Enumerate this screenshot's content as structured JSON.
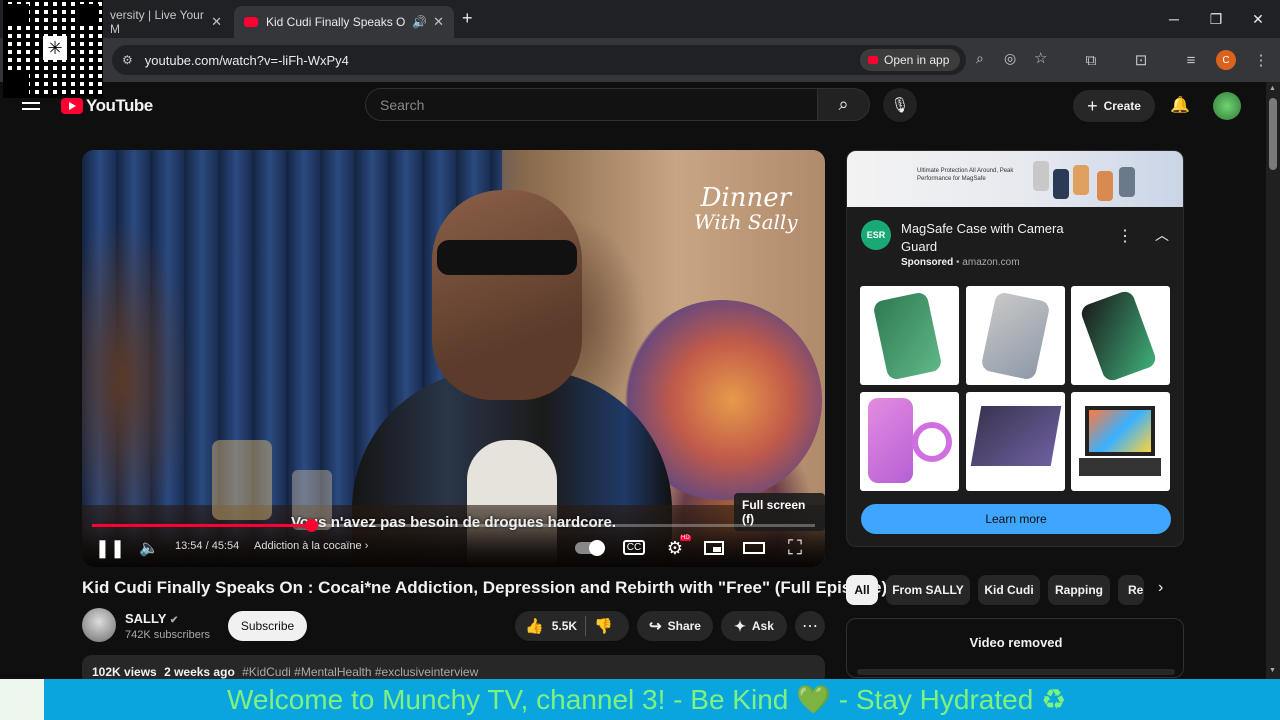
{
  "browser": {
    "tabs": [
      {
        "label": "versity | Live Your M",
        "active": false
      },
      {
        "label": "Kid Cudi Finally Speaks On :",
        "active": true
      }
    ],
    "new_tab": "+",
    "url": "youtube.com/watch?v=-liFh-WxPy4",
    "open_in_app": "Open in app",
    "profile_initial": "C"
  },
  "youtube": {
    "logo": "YouTube",
    "search_placeholder": "Search",
    "create_label": "Create"
  },
  "player": {
    "brand_line1": "Dinner",
    "brand_line2": "With Sally",
    "subtitle": "Vous n'avez pas besoin de drogues hardcore.",
    "tooltip": "Full screen (f)",
    "time": "13:54 / 45:54",
    "chapter": "Addiction à la cocaïne",
    "progress": 0.3027,
    "hd_badge": "HD"
  },
  "video": {
    "title": "Kid Cudi Finally Speaks On : Cocai*ne Addiction, Depression and Rebirth with \"Free\" (Full Episode)",
    "channel": "SALLY",
    "subscribers": "742K subscribers",
    "subscribe_label": "Subscribe",
    "likes": "5.5K",
    "share_label": "Share",
    "ask_label": "Ask",
    "views": "102K views",
    "age": "2 weeks ago",
    "hashtags": "#KidCudi #MentalHealth #exclusiveinterview"
  },
  "ad": {
    "banner_text": "Ultimate Protection All Around, Peak Performance for MagSafe",
    "logo_text": "ESR",
    "title": "MagSafe Case with Camera Guard",
    "sponsored": "Sponsored",
    "domain": "amazon.com",
    "cta": "Learn more"
  },
  "chips": [
    "All",
    "From SALLY",
    "Kid Cudi",
    "Rapping",
    "Re"
  ],
  "removed_label": "Video removed",
  "ticker": "Welcome to Munchy TV, channel 3!  - Be Kind 💚 - Stay Hydrated ♻",
  "colors": {
    "accent": "#ff0033",
    "link_blue": "#3ea6ff",
    "ticker_bg": "#0aa5df",
    "ticker_text": "#7ef27e"
  }
}
